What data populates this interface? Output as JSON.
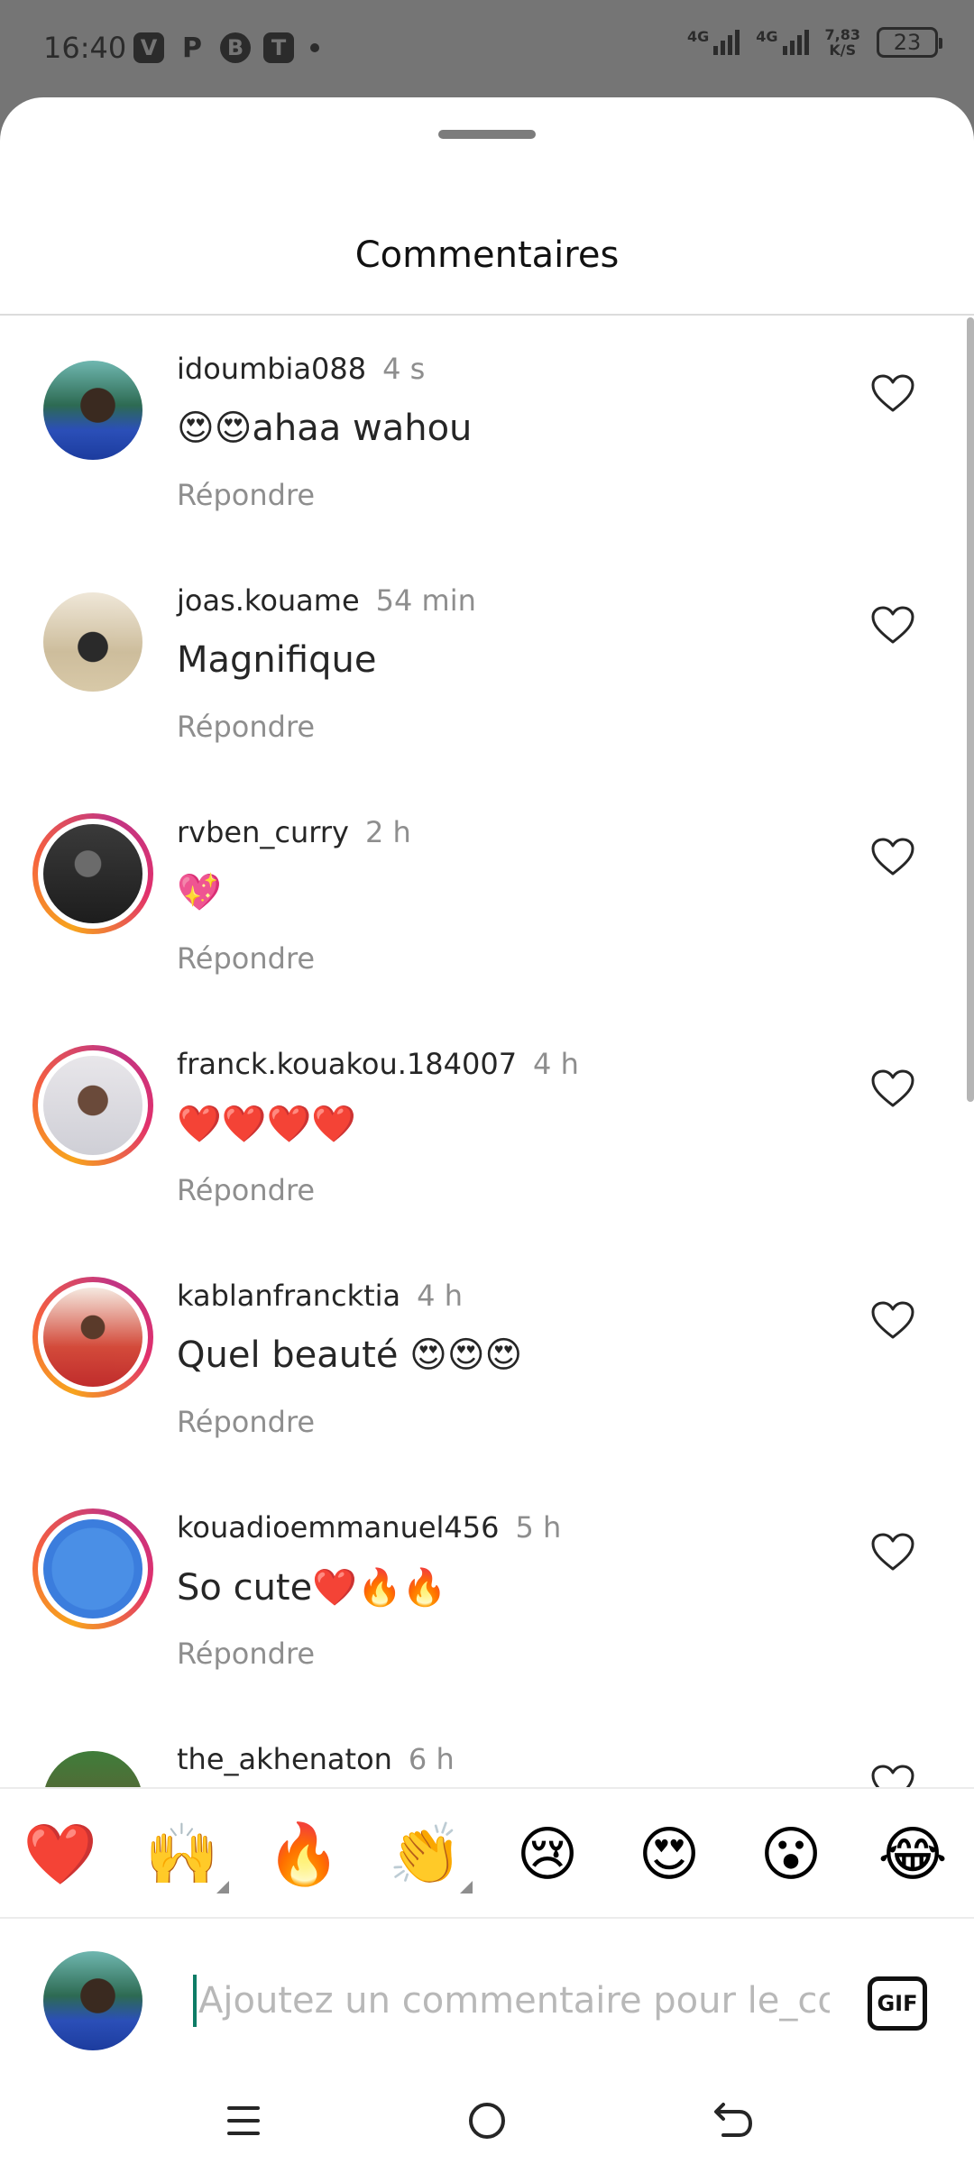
{
  "status_bar": {
    "time": "16:40",
    "app_icons": [
      "V",
      "P",
      "B",
      "T"
    ],
    "network_1": "4G",
    "network_2": "4G",
    "speed_value": "7,83",
    "speed_unit": "K/S",
    "battery": "23"
  },
  "sheet": {
    "title": "Commentaires"
  },
  "comments": [
    {
      "username": "idoumbia088",
      "time": "4 s",
      "text": "😍😍ahaa wahou",
      "reply": "Répondre"
    },
    {
      "username": "joas.kouame",
      "time": "54 min",
      "text": "Magnifique",
      "reply": "Répondre"
    },
    {
      "username": "rvben_curry",
      "time": "2 h",
      "text": "💖",
      "reply": "Répondre"
    },
    {
      "username": "franck.kouakou.184007",
      "time": "4 h",
      "text": "❤️❤️❤️❤️",
      "reply": "Répondre"
    },
    {
      "username": "kablanfrancktia",
      "time": "4 h",
      "text": "Quel beauté 😍😍😍",
      "reply": "Répondre"
    },
    {
      "username": "kouadioemmanuel456",
      "time": "5 h",
      "text": "So cute❤️🔥🔥",
      "reply": "Répondre"
    },
    {
      "username": "the_akhenaton",
      "time": "6 h",
      "text": "",
      "reply": ""
    }
  ],
  "emoji_bar": [
    "❤️",
    "🙌",
    "🔥",
    "👏",
    "😢",
    "😍",
    "😮",
    "😂"
  ],
  "input": {
    "placeholder": "Ajoutez un commentaire pour le_coo",
    "gif_label": "GIF"
  },
  "colors": {
    "accent_cursor": "#0d7c66",
    "story_ring_start": "#f7a41d",
    "story_ring_end": "#c13584",
    "muted_text": "#8e8e8e"
  }
}
